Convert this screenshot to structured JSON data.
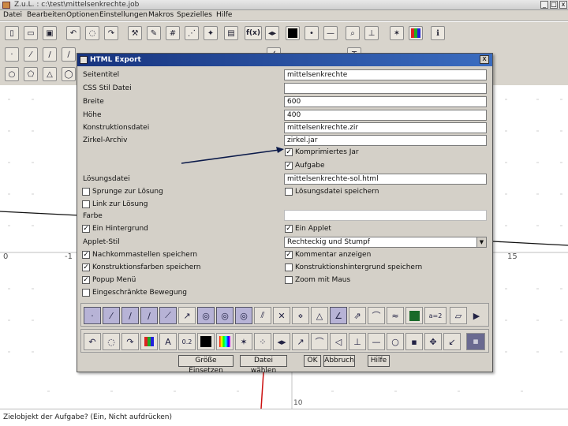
{
  "window": {
    "title": "Z.u.L. : c:\\test\\mittelsenkrechte.job",
    "minimize": "_",
    "maximize": "□",
    "close": "x"
  },
  "menu": [
    "Datei",
    "Bearbeiten",
    "Optionen",
    "Einstellungen",
    "Makros",
    "Spezielles",
    "Hilfe"
  ],
  "toolbar_top_icons": [
    "new-file-icon",
    "open-folder-icon",
    "save-icon",
    "undo-icon",
    "hide-icon",
    "redo-icon",
    "wrench-icon",
    "paint-icon",
    "grid-icon",
    "settings-icon",
    "clipboard-icon",
    "function-icon",
    "arrows-icon",
    "black-square-icon",
    "dot-icon",
    "line-icon",
    "zoom-icon",
    "axis-icon",
    "magic-icon",
    "color-palette-icon",
    "info-icon"
  ],
  "toolbar_second_icons": [
    "point-icon",
    "segment-icon",
    "ray-icon",
    "line2-icon",
    "circle-icon",
    "circle2-icon",
    "triangle-icon",
    "polygon-icon",
    "angle-icon",
    "text-icon"
  ],
  "function_label": "f(x)",
  "canvas": {
    "x_labels": [
      "0",
      "-1",
      "15"
    ],
    "y_label": "10"
  },
  "status": "Zielobjekt der Aufgabe? (Ein, Nicht aufdrücken)",
  "dialog": {
    "title": "HTML Export",
    "close": "x",
    "rows": {
      "seitentitel_label": "Seitentitel",
      "seitentitel_value": "mittelsenkrechte",
      "css_label": "CSS Stil Datei",
      "css_value": "",
      "breite_label": "Breite",
      "breite_value": "600",
      "hoehe_label": "Höhe",
      "hoehe_value": "400",
      "konstruktion_label": "Konstruktionsdatei",
      "konstruktion_value": "mittelsenkrechte.zir",
      "zirkel_label": "Zirkel-Archiv",
      "zirkel_value": "zirkel.jar",
      "komprimiert_label": "Komprimiertes Jar",
      "komprimiert_checked": true,
      "aufgabe_label": "Aufgabe",
      "aufgabe_checked": true,
      "loesung_label": "Lösungsdatei",
      "loesung_value": "mittelsenkrechte-sol.html",
      "sprunge_label": "Sprunge zur Lösung",
      "sprunge_checked": false,
      "loesungsdatei_speichern_label": "Lösungsdatei speichern",
      "loesungsdatei_speichern_checked": false,
      "link_label": "Link zur Lösung",
      "link_checked": false,
      "farbe_label": "Farbe",
      "farbe_value": "",
      "hintergrund_label": "Ein Hintergrund",
      "hintergrund_checked": true,
      "applet_label": "Ein Applet",
      "applet_checked": true,
      "applet_stil_label": "Applet-Stil",
      "applet_stil_value": "Rechteckig und Stumpf",
      "nachkomma_label": "Nachkommastellen speichern",
      "nachkomma_checked": true,
      "kommentar_label": "Kommentar anzeigen",
      "kommentar_checked": true,
      "konstruktionsfarben_label": "Konstruktionsfarben speichern",
      "konstruktionsfarben_checked": true,
      "hintergrund_speichern_label": "Konstruktionshintergrund speichern",
      "hintergrund_speichern_checked": false,
      "popup_label": "Popup Menü",
      "popup_checked": true,
      "zoom_label": "Zoom mit Maus",
      "zoom_checked": false,
      "bewegung_label": "Eingeschränkte Bewegung",
      "bewegung_checked": false
    },
    "tools_row1": [
      "point-tool-icon",
      "segment-tool-icon",
      "ray-tool-icon",
      "line-tool-icon",
      "line-tool-2-icon",
      "vector-tool-icon",
      "circle-tool-icon",
      "circle-tool-2-icon",
      "circle-tool-3-icon",
      "parallel-tool-icon",
      "intersection-tool-icon",
      "midpoint-tool-icon",
      "triangle-tool-icon",
      "angle-tool-icon",
      "arrow-tool-icon",
      "reflect-tool-icon",
      "symmetric-tool-icon",
      "expression-tool-icon",
      "assign-tool-icon",
      "polygon-tool-icon",
      "more-tools-icon"
    ],
    "tools_row1_text": "a=2",
    "tools_row2": [
      "undo-tool-icon",
      "hide-tool-icon",
      "redo-tool-icon",
      "color-tool-icon",
      "text-tool-icon",
      "number-tool-icon",
      "black-tool-icon",
      "rainbow-tool-icon",
      "magic-tool-icon",
      "grid-tool-icon",
      "arrows-tool-icon",
      "pen-tool-icon",
      "arc-tool-icon",
      "fill-tool-icon",
      "axis-tool-icon",
      "line-draw-tool-icon",
      "circle-draw-tool-icon",
      "dot-tool-icon",
      "move-tool-icon",
      "delete-tool-icon"
    ],
    "tools_row2_text": "0.2",
    "buttons": {
      "groesse": "Größe Einsetzen",
      "datei": "Datei wählen",
      "ok": "OK",
      "abbruch": "Abbruch",
      "hilfe": "Hilfe"
    }
  }
}
